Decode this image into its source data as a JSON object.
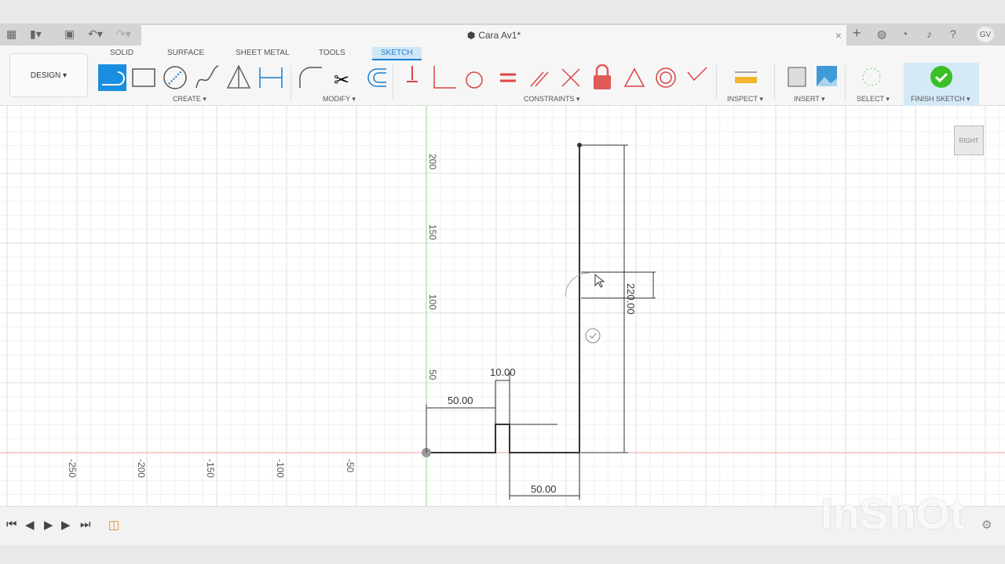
{
  "app": {
    "doc_title": "Cara Av1*",
    "user_initials": "GV"
  },
  "ribbon": {
    "workspace": "DESIGN ▾",
    "tabs": [
      "SOLID",
      "SURFACE",
      "SHEET METAL",
      "TOOLS",
      "SKETCH"
    ],
    "active_tab": "SKETCH",
    "groups": [
      "CREATE ▾",
      "MODIFY ▾",
      "CONSTRAINTS ▾",
      "INSPECT ▾",
      "INSERT ▾",
      "SELECT ▾",
      "FINISH SKETCH ▾"
    ]
  },
  "canvas": {
    "y_ticks": [
      "200",
      "150",
      "100",
      "50"
    ],
    "x_ticks": [
      "-250",
      "-200",
      "-150",
      "-100",
      "-50"
    ],
    "dimensions": [
      "50.00",
      "10.00",
      "50.00",
      "220.00"
    ],
    "viewcube": "RIGHT"
  },
  "colors": {
    "accent": "#1a7fd3",
    "finish": "#3bbf27",
    "x_axis": "#f0a0a0",
    "y_axis": "#8fd48f"
  },
  "watermark": "InShOt"
}
